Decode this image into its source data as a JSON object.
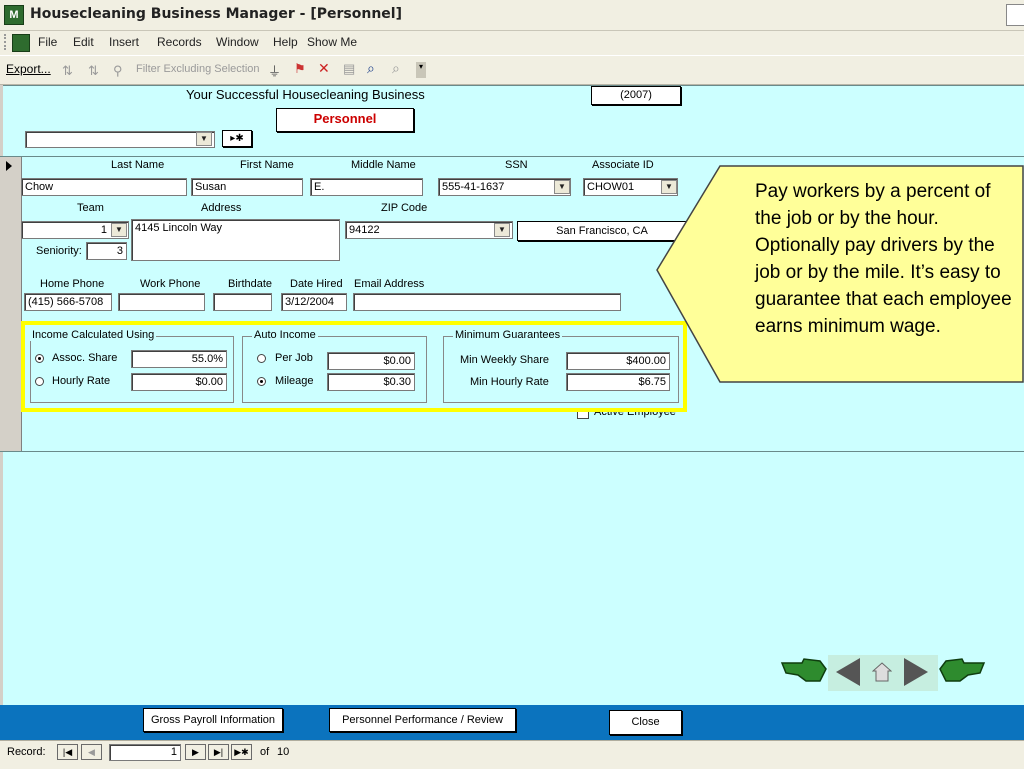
{
  "window": {
    "title": "Housecleaning Business Manager - [Personnel]",
    "app_icon": "M"
  },
  "menu": [
    "File",
    "Edit",
    "Insert",
    "Records",
    "Window",
    "Help",
    "Show Me"
  ],
  "toolbar": {
    "export_label": "Export...",
    "filter_label": "Filter Excluding Selection"
  },
  "header": {
    "business_name": "Your Successful Housecleaning Business",
    "year": "(2007)",
    "form_title": "Personnel",
    "title_color": "#cc0000"
  },
  "record_selector": {
    "value": "",
    "new_label": "▸✱"
  },
  "labels": {
    "last_name": "Last Name",
    "first_name": "First Name",
    "middle_name": "Middle Name",
    "ssn": "SSN",
    "associate_id": "Associate ID",
    "team": "Team",
    "address": "Address",
    "zip": "ZIP Code",
    "seniority": "Seniority:",
    "home_phone": "Home Phone",
    "work_phone": "Work Phone",
    "birthdate": "Birthdate",
    "date_hired": "Date Hired",
    "email": "Email Address"
  },
  "employee": {
    "last_name": "Chow",
    "first_name": "Susan",
    "middle_name": "E.",
    "ssn": "555-41-1637",
    "associate_id": "CHOW01",
    "team": "1",
    "address": "4145 Lincoln Way",
    "zip": "94122",
    "city_state": "San Francisco, CA",
    "seniority": "3",
    "home_phone": "(415) 566-5708",
    "work_phone": "",
    "birthdate": "",
    "date_hired": "3/12/2004",
    "email": ""
  },
  "income": {
    "title": "Income Calculated Using",
    "assoc_share_label": "Assoc. Share",
    "assoc_share": "55.0%",
    "hourly_rate_label": "Hourly Rate",
    "hourly_rate": "$0.00",
    "selected": "assoc_share"
  },
  "auto_income": {
    "title": "Auto Income",
    "per_job_label": "Per Job",
    "per_job": "$0.00",
    "mileage_label": "Mileage",
    "mileage": "$0.30",
    "selected": "mileage"
  },
  "minimum": {
    "title": "Minimum Guarantees",
    "weekly_label": "Min Weekly Share",
    "weekly": "$400.00",
    "hourly_label": "Min Hourly Rate",
    "hourly": "$6.75"
  },
  "active_employee_label": "Active Employee",
  "callout": "Pay workers by a percent of the job or by the hour. Optionally pay drivers by the job or by the mile.  It’s easy to guarantee that each employee earns minimum wage.",
  "buttons": {
    "gross_payroll": "Gross Payroll Information",
    "performance": "Personnel Performance / Review",
    "close": "Close"
  },
  "record_nav": {
    "label": "Record:",
    "current": "1",
    "of_label": "of",
    "total": "10"
  },
  "colors": {
    "form_bg": "#ccffff",
    "highlight": "#ffff00",
    "callout_bg": "#ffff99",
    "bottom_bar": "#0b73be"
  }
}
